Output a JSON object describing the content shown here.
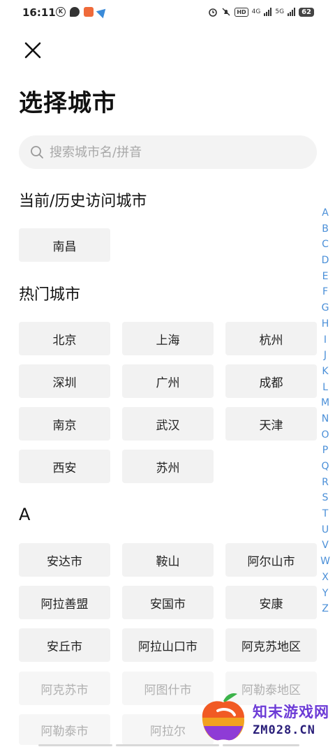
{
  "status_bar": {
    "time": "16:11",
    "left_icons": [
      "k-badge-icon",
      "message-icon",
      "app-icon",
      "telegram-icon"
    ],
    "right_icons": [
      "alarm-icon",
      "mute-icon",
      "hd-icon",
      "4g-signal-icon",
      "5g-signal-icon"
    ],
    "hd_label": "HD",
    "net1": "4G",
    "net2": "5G",
    "battery": "62"
  },
  "header": {
    "close_icon": "close-icon",
    "title": "选择城市"
  },
  "search": {
    "placeholder": "搜索城市名/拼音",
    "icon": "search-icon"
  },
  "sections": {
    "history_title": "当前/历史访问城市",
    "history": [
      "南昌"
    ],
    "hot_title": "热门城市",
    "hot": [
      "北京",
      "上海",
      "杭州",
      "深圳",
      "广州",
      "成都",
      "南京",
      "武汉",
      "天津",
      "西安",
      "苏州"
    ],
    "a_title": "A",
    "a_cities": [
      "安达市",
      "鞍山",
      "阿尔山市",
      "阿拉善盟",
      "安国市",
      "安康",
      "安丘市",
      "阿拉山口市",
      "阿克苏地区",
      "阿克苏市",
      "阿图什市",
      "阿勒泰地区",
      "阿勒泰市",
      "阿拉尔"
    ]
  },
  "alphabet": [
    "A",
    "B",
    "C",
    "D",
    "E",
    "F",
    "G",
    "H",
    "I",
    "J",
    "K",
    "L",
    "M",
    "N",
    "O",
    "P",
    "Q",
    "R",
    "S",
    "T",
    "U",
    "V",
    "W",
    "X",
    "Y",
    "Z"
  ],
  "watermark": {
    "text": "知末游戏网",
    "url": "ZM028.CN"
  }
}
